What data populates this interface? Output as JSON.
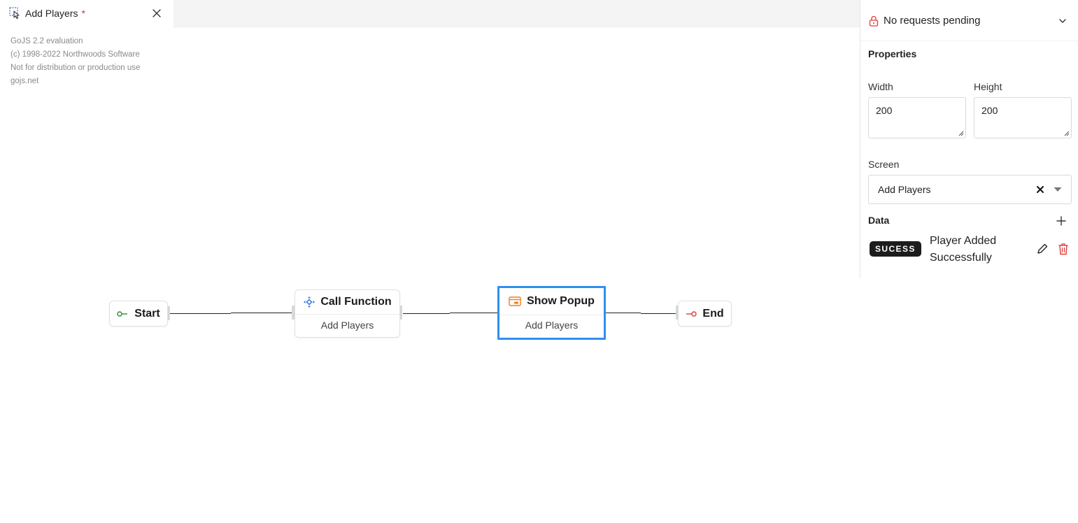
{
  "tab": {
    "title": "Add Players",
    "dirty_marker": "*",
    "icon": "cursor-click-icon",
    "close_icon": "close-icon"
  },
  "watermark": {
    "lines": [
      "GoJS 2.2 evaluation",
      "(c) 1998-2022 Northwoods Software",
      "Not for distribution or production use",
      "gojs.net"
    ]
  },
  "diagram": {
    "nodes": [
      {
        "id": "start",
        "title": "Start",
        "icon": "start-icon",
        "color": "#2e8b3a"
      },
      {
        "id": "call-function",
        "title": "Call Function",
        "subtitle": "Add Players",
        "icon": "function-icon",
        "color": "#2f6fe0"
      },
      {
        "id": "show-popup",
        "title": "Show Popup",
        "subtitle": "Add Players",
        "icon": "popup-icon",
        "color": "#f07d1a",
        "selected": true
      },
      {
        "id": "end",
        "title": "End",
        "icon": "end-icon",
        "color": "#e03b3b"
      }
    ],
    "selection_color": "#2f8ff0"
  },
  "panel": {
    "requests": {
      "text": "No requests pending",
      "icon": "lock-icon",
      "accent": "#e03b3b"
    },
    "properties": {
      "title": "Properties",
      "width_label": "Width",
      "width_value": "200",
      "height_label": "Height",
      "height_value": "200",
      "screen_label": "Screen",
      "screen_value": "Add Players"
    },
    "data": {
      "title": "Data",
      "items": [
        {
          "key": "SUCESS",
          "value": "Player Added Successfully"
        }
      ]
    }
  }
}
